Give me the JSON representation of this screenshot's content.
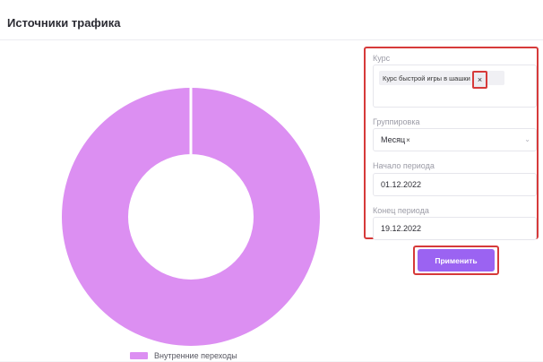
{
  "header": {
    "title": "Источники трафика"
  },
  "form": {
    "course": {
      "label": "Курс",
      "chip_text": "Курс быстрой игры в шашки",
      "chip_close": "×"
    },
    "grouping": {
      "label": "Группировка",
      "value": "Месяц",
      "clear": "×",
      "chevron": "⌄"
    },
    "start": {
      "label": "Начало периода",
      "value": "01.12.2022"
    },
    "end": {
      "label": "Конец периода",
      "value": "19.12.2022"
    },
    "apply_label": "Применить"
  },
  "colors": {
    "slice": "#dc8ff2",
    "accent": "#9b63f2",
    "highlight": "#d63a3a"
  },
  "chart_data": {
    "type": "pie",
    "subtype": "donut",
    "title": "",
    "series": [
      {
        "name": "Внутренние переходы",
        "value": 100
      }
    ],
    "legend": "bottom",
    "legend_items": [
      "Внутренние переходы"
    ]
  }
}
